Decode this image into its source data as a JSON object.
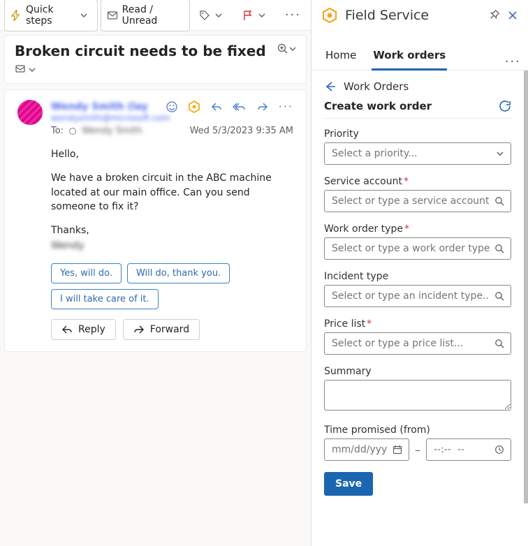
{
  "toolbar": {
    "quick_steps": "Quick steps",
    "read_unread": "Read / Unread"
  },
  "subject": {
    "title": "Broken circuit needs to be fixed"
  },
  "message": {
    "sender_name": "Wendy Smith (lay",
    "sender_email": "wendysmith@microsoft.com",
    "to_label": "To:",
    "to_name": "Wendy Smith",
    "timestamp": "Wed 5/3/2023 9:35 AM",
    "body": {
      "greeting": "Hello,",
      "para1": "We have a broken circuit in the ABC machine located at   our main office. Can you send someone to fix it?",
      "thanks": "Thanks,",
      "signature": "Wendy"
    },
    "suggested": [
      "Yes, will do.",
      "Will do, thank you.",
      "I will take care of it."
    ],
    "reply_label": "Reply",
    "forward_label": "Forward"
  },
  "panel": {
    "title": "Field Service",
    "tabs": {
      "home": "Home",
      "work_orders": "Work orders",
      "active": "work_orders"
    },
    "breadcrumb": "Work Orders",
    "create_title": "Create work order",
    "fields": {
      "priority": {
        "label": "Priority",
        "placeholder": "Select a priority..."
      },
      "service_account": {
        "label": "Service account",
        "placeholder": "Select or type a service account..."
      },
      "work_order_type": {
        "label": "Work order type",
        "placeholder": "Select or type a work order type..."
      },
      "incident_type": {
        "label": "Incident type",
        "placeholder": "Select or type an incident type..."
      },
      "price_list": {
        "label": "Price list",
        "placeholder": "Select or type a price list..."
      },
      "summary": {
        "label": "Summary"
      },
      "time_promised": {
        "label": "Time promised (from)",
        "date_placeholder": "mm/dd/yyyy",
        "time_placeholder": "--:--  --"
      }
    },
    "save_label": "Save"
  }
}
